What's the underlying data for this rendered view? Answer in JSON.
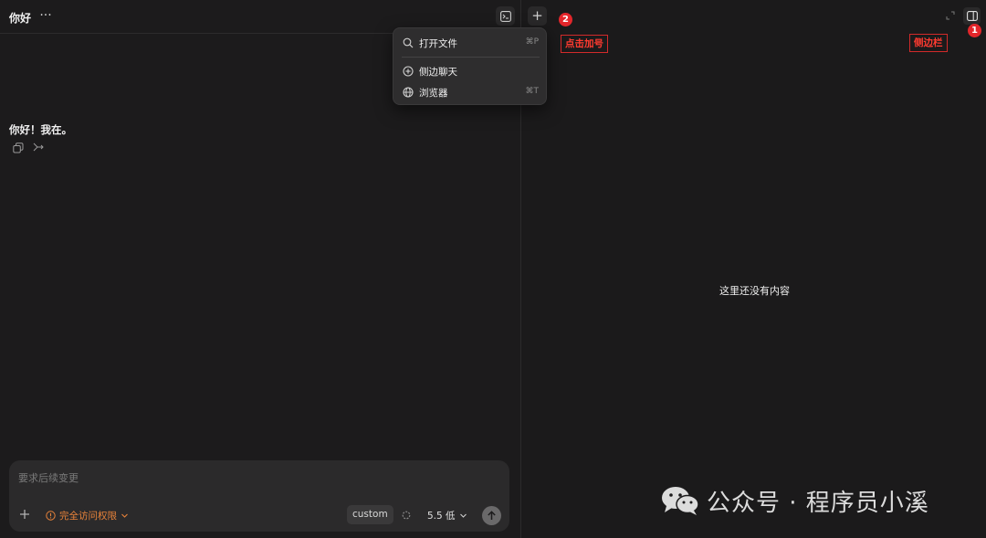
{
  "header": {
    "title": "你好",
    "more_label": "···"
  },
  "conversation": {
    "message": "你好！我在。"
  },
  "menu": {
    "items": [
      {
        "label": "打开文件",
        "shortcut": "⌘P",
        "icon": "search-icon"
      },
      {
        "label": "侧边聊天",
        "shortcut": "",
        "icon": "plus-circle-icon"
      },
      {
        "label": "浏览器",
        "shortcut": "⌘T",
        "icon": "globe-icon"
      }
    ]
  },
  "composer": {
    "placeholder": "要求后续变更",
    "permission_label": "完全访问权限",
    "custom_label": "custom",
    "model_label": "5.5 低"
  },
  "right_panel": {
    "empty_text": "这里还没有内容"
  },
  "annotations": {
    "step_1": "1",
    "step_2": "2",
    "plus_callout": "点击加号",
    "sidebar_callout": "侧边栏"
  },
  "watermark": {
    "text": "公众号 · 程序员小溪"
  },
  "colors": {
    "background": "#1c1b1c",
    "panel": "#2b2a2b",
    "permission_accent": "#e8833a",
    "annotation_red": "#e3262b"
  }
}
